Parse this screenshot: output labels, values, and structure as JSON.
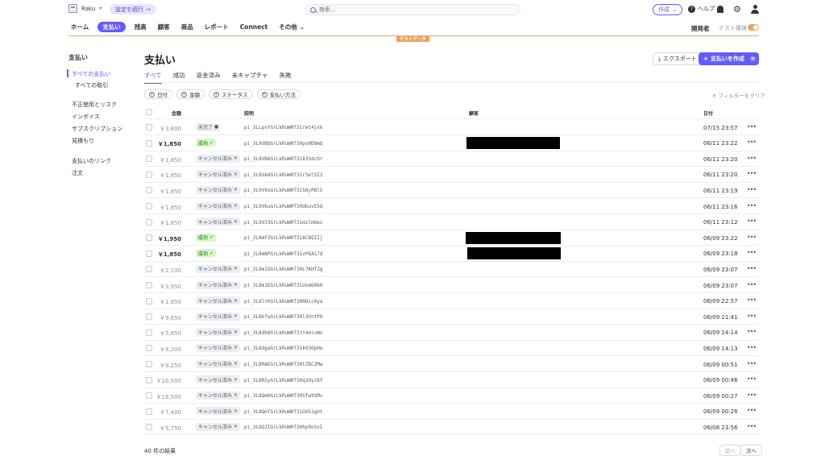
{
  "topbar": {
    "account_name": "Raku",
    "setup_label": "設定を続行",
    "search_placeholder": "検索...",
    "create_label": "作成",
    "help_label": "ヘルプ"
  },
  "nav": {
    "items": [
      "ホーム",
      "支払い",
      "残高",
      "顧客",
      "商品",
      "レポート",
      "Connect",
      "その他"
    ],
    "developer_label": "開発者",
    "test_mode_label": "テスト環境",
    "test_data_badge": "テストデータ"
  },
  "sidebar": {
    "title": "支払い",
    "items": [
      "すべての支払い",
      "すべての取引",
      "不正使用とリスク",
      "インボイス",
      "サブスクリプション",
      "見積もり",
      "支払いのリンク",
      "注文"
    ]
  },
  "main": {
    "title": "支払い",
    "export_label": "エクスポート",
    "new_payment_label": "支払いを作成",
    "new_payment_shortcut": "n",
    "tabs": [
      "すべて",
      "成功",
      "返金済み",
      "未キャプチャ",
      "失敗"
    ],
    "filters": [
      "日付",
      "金額",
      "ステータス",
      "支払い方法"
    ],
    "clear_filters": "フィルターをクリア"
  },
  "table": {
    "headers": {
      "amount": "金額",
      "description": "説明",
      "customer": "顧客",
      "date": "日付"
    },
    "rows": [
      {
        "amount": "￥3,800",
        "status": "未完了",
        "status_type": "incomplete",
        "desc": "pi_3LLpxYGrLkRuWHT31rmt4jxk",
        "customer_redacted": false,
        "date": "07/15 23:57"
      },
      {
        "amount": "￥1,850",
        "status": "成功",
        "status_type": "success",
        "desc": "pi_3L9VBOGrLkRuWHT30poHD9mQ",
        "customer_redacted": true,
        "date": "06/11 23:22"
      },
      {
        "amount": "￥1,850",
        "status": "キャンセル済み",
        "status_type": "canceled",
        "desc": "pi_3L9VB8GrLkRuWHT3183SdcOr",
        "customer_redacted": false,
        "date": "06/11 23:20"
      },
      {
        "amount": "￥1,850",
        "status": "キャンセル済み",
        "status_type": "canceled",
        "desc": "pi_3L9VAdGrLkRuWHT31r3elSI3",
        "customer_redacted": false,
        "date": "06/11 23:20"
      },
      {
        "amount": "￥1,850",
        "status": "キャンセル済み",
        "status_type": "canceled",
        "desc": "pi_3L9V9sGrLkRuWHT3158yPBl5",
        "customer_redacted": false,
        "date": "06/11 23:19"
      },
      {
        "amount": "￥1,850",
        "status": "キャンセル済み",
        "status_type": "canceled",
        "desc": "pi_3L9V6uGrLkRuWHT30UbuvE5Q",
        "customer_redacted": false,
        "date": "06/11 23:16"
      },
      {
        "amount": "￥1,850",
        "status": "キャンセル済み",
        "status_type": "canceled",
        "desc": "pi_3L9V33GrLkRuWHT31miCmOez",
        "customer_redacted": false,
        "date": "06/11 23:12"
      },
      {
        "amount": "￥1,950",
        "status": "成功",
        "status_type": "success",
        "desc": "pi_3L8mF3GrLkRuWHT318CBQIIj",
        "customer_redacted": true,
        "date": "06/09 23:22"
      },
      {
        "amount": "￥1,850",
        "status": "成功",
        "status_type": "success",
        "desc": "pi_3L8mBPGrLkRuWHT31vP6A17d",
        "customer_redacted": true,
        "date": "06/09 23:18"
      },
      {
        "amount": "￥2,100",
        "status": "キャンセル済み",
        "status_type": "canceled",
        "desc": "pi_3L8m1SGrLkRuWHT30L7KHTZg",
        "customer_redacted": false,
        "date": "06/09 23:07"
      },
      {
        "amount": "￥3,950",
        "status": "キャンセル済み",
        "status_type": "canceled",
        "desc": "pi_3L8m1EGrLkRuWHT31UxmO0k0",
        "customer_redacted": false,
        "date": "06/09 23:07"
      },
      {
        "amount": "￥1,850",
        "status": "キャンセル済み",
        "status_type": "canceled",
        "desc": "pi_3L8lrKGrLkRuWHT30N9ic0ya",
        "customer_redacted": false,
        "date": "06/09 22:57"
      },
      {
        "amount": "￥9,650",
        "status": "キャンセル済み",
        "status_type": "canceled",
        "desc": "pi_3L8kfwGrLkRuWHT30l3VntP0",
        "customer_redacted": false,
        "date": "06/09 21:41"
      },
      {
        "amount": "￥5,850",
        "status": "キャンセル済み",
        "status_type": "canceled",
        "desc": "pi_3L8dh8GrLkRuWHT31Y44ivWn",
        "customer_redacted": false,
        "date": "06/09 14:14"
      },
      {
        "amount": "￥4,200",
        "status": "キャンセル済み",
        "status_type": "canceled",
        "desc": "pi_3L8dgaGrLkRuWHT31k03OpHe",
        "customer_redacted": false,
        "date": "06/09 14:13"
      },
      {
        "amount": "￥9,250",
        "status": "キャンセル済み",
        "status_type": "canceled",
        "desc": "pi_3L8RAEGrLkRuWHT30tZ8CZMw",
        "customer_redacted": false,
        "date": "06/09 00:51"
      },
      {
        "amount": "￥10,500",
        "status": "キャンセル済み",
        "status_type": "canceled",
        "desc": "pi_3L8R5yGrLkRuWHT30q3Oyz8f",
        "customer_redacted": false,
        "date": "06/09 00:46"
      },
      {
        "amount": "￥18,500",
        "status": "キャンセル済み",
        "status_type": "canceled",
        "desc": "pi_3L8Qm0GrLkRuWHT30Sfw9SMv",
        "customer_redacted": false,
        "date": "06/09 00:27"
      },
      {
        "amount": "￥7,400",
        "status": "キャンセル済み",
        "status_type": "canceled",
        "desc": "pi_3L8QmTGrLkRuWHT31OX51gUt",
        "customer_redacted": false,
        "date": "06/09 00:26"
      },
      {
        "amount": "￥5,750",
        "status": "キャンセル済み",
        "status_type": "canceled",
        "desc": "pi_3L8QJIGrLkRuWHT30hp9oSxI",
        "customer_redacted": false,
        "date": "06/08 23:56"
      }
    ]
  },
  "footer": {
    "results_label": "40 件の結果",
    "prev_label": "前へ",
    "next_label": "次へ"
  },
  "colors": {
    "accent": "#635bff",
    "test_mode": "#f0a058",
    "success_bg": "#d7f7c2"
  }
}
